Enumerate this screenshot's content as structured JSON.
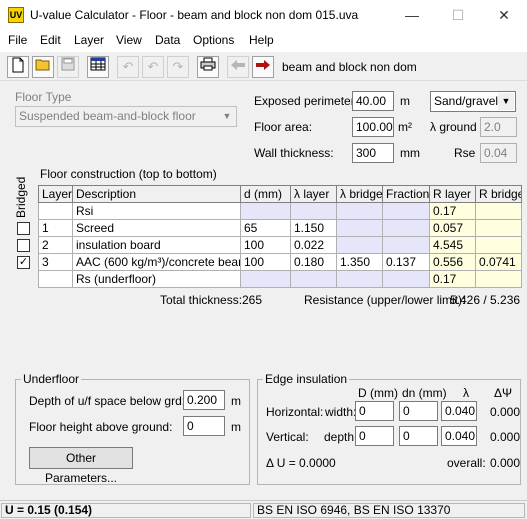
{
  "window": {
    "title": "U-value Calculator - Floor - beam and block non dom 015.uva",
    "icon_text": "UV",
    "minimize": "—",
    "maximize": "☐",
    "close": "✕"
  },
  "menu": [
    "File",
    "Edit",
    "Layer",
    "View",
    "Data",
    "Options",
    "Help"
  ],
  "toolbar": {
    "file_name": "beam and block non dom",
    "icons": [
      "new-file-icon",
      "open-folder-icon",
      "save-icon",
      "table-icon",
      "undo-icon",
      "undo-all-icon",
      "redo-icon",
      "print-icon",
      "back-arrow-icon",
      "forward-arrow-icon"
    ]
  },
  "floor_type": {
    "label": "Floor Type",
    "value": "Suspended beam-and-block floor"
  },
  "exposed_perimeter": {
    "label": "Exposed perimeter:",
    "value": "40.00",
    "unit": "m"
  },
  "soil": {
    "value": "Sand/gravel"
  },
  "floor_area": {
    "label": "Floor area:",
    "value": "100.00",
    "unit": "m²"
  },
  "lambda_ground": {
    "label": "λ ground",
    "value": "2.0"
  },
  "wall_thickness": {
    "label": "Wall thickness:",
    "value": "300",
    "unit": "mm"
  },
  "rse": {
    "label": "Rse",
    "value": "0.04"
  },
  "construction": {
    "title": "Floor construction (top to bottom)",
    "bridged_label": "Bridged",
    "columns": [
      "Layer",
      "Description",
      "d (mm)",
      "λ layer",
      "λ bridge",
      "Fraction",
      "R layer",
      "R bridge"
    ],
    "rows": [
      {
        "checkbox": null,
        "layer": "",
        "description": "Rsi",
        "d": "",
        "lambda_layer": "",
        "lambda_bridge": "",
        "fraction": "",
        "r_layer": "0.17",
        "r_bridge": ""
      },
      {
        "checkbox": "",
        "layer": "1",
        "description": "Screed",
        "d": "65",
        "lambda_layer": "1.150",
        "lambda_bridge": "",
        "fraction": "",
        "r_layer": "0.057",
        "r_bridge": ""
      },
      {
        "checkbox": "",
        "layer": "2",
        "description": "insulation board",
        "d": "100",
        "lambda_layer": "0.022",
        "lambda_bridge": "",
        "fraction": "",
        "r_layer": "4.545",
        "r_bridge": ""
      },
      {
        "checkbox": "✓",
        "layer": "3",
        "description": "AAC (600 kg/m³)/concrete beams",
        "d": "100",
        "lambda_layer": "0.180",
        "lambda_bridge": "1.350",
        "fraction": "0.137",
        "r_layer": "0.556",
        "r_bridge": "0.0741"
      },
      {
        "checkbox": null,
        "layer": "",
        "description": "Rs (underfloor)",
        "d": "",
        "lambda_layer": "",
        "lambda_bridge": "",
        "fraction": "",
        "r_layer": "0.17",
        "r_bridge": ""
      }
    ],
    "total_thickness_label": "Total thickness:",
    "total_thickness": "265",
    "resistance_label": "Resistance (upper/lower limit):",
    "resistance": "5.426 / 5.236"
  },
  "underfloor": {
    "title": "Underfloor",
    "depth_label": "Depth of u/f space below grd:",
    "depth_value": "0.200",
    "depth_unit": "m",
    "height_label": "Floor height above ground:",
    "height_value": "0",
    "height_unit": "m",
    "other_button": "Other Parameters..."
  },
  "edge_insulation": {
    "title": "Edge insulation",
    "col_d": "D (mm)",
    "col_dn": "dn (mm)",
    "col_lambda": "λ",
    "col_dpsi": "ΔΨ",
    "horizontal": {
      "label": "Horizontal:",
      "sub": "width:",
      "d": "0",
      "dn": "0",
      "lambda": "0.040",
      "dpsi": "0.000"
    },
    "vertical": {
      "label": "Vertical:",
      "sub": "depth:",
      "d": "0",
      "dn": "0",
      "lambda": "0.040",
      "dpsi": "0.000"
    },
    "delta_u": "Δ U = 0.0000",
    "overall_label": "overall:",
    "overall_value": "0.000"
  },
  "status": {
    "u_value": "U = 0.15  (0.154)",
    "standards": "BS EN ISO 6946, BS EN ISO 13370"
  }
}
